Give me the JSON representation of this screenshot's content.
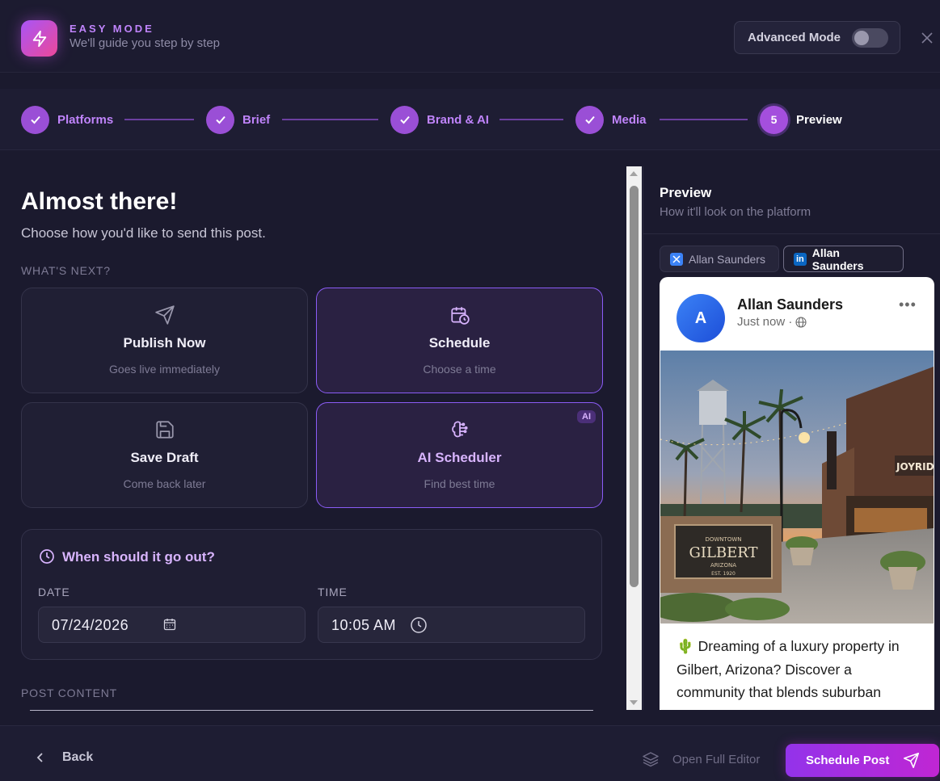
{
  "header": {
    "brand_title": "EASY MODE",
    "brand_subtitle": "We'll guide you step by step",
    "advanced_mode_label": "Advanced Mode",
    "advanced_mode_on": false,
    "close_icon": "close-icon"
  },
  "stepper": {
    "steps": [
      {
        "label": "Platforms",
        "state": "done"
      },
      {
        "label": "Brief",
        "state": "done"
      },
      {
        "label": "Brand & AI",
        "state": "done"
      },
      {
        "label": "Media",
        "state": "done"
      },
      {
        "label": "Preview",
        "state": "active",
        "number": "5"
      }
    ]
  },
  "main": {
    "title": "Almost there!",
    "subtitle": "Choose how you'd like to send this post.",
    "section_label": "WHAT'S NEXT?",
    "options": [
      {
        "title": "Publish Now",
        "subtitle": "Goes live immediately",
        "icon": "send-icon",
        "selected": false
      },
      {
        "title": "Schedule",
        "subtitle": "Choose a time",
        "icon": "calendar-clock-icon",
        "selected": true
      },
      {
        "title": "Save Draft",
        "subtitle": "Come back later",
        "icon": "save-icon",
        "selected": false
      },
      {
        "title": "AI Scheduler",
        "subtitle": "Find best time",
        "icon": "brain-icon",
        "selected": true,
        "badge": "AI"
      }
    ],
    "when": {
      "title": "When should it go out?",
      "date_label": "DATE",
      "date_value": "07/24/2026",
      "time_label": "TIME",
      "time_value": "10:05 AM"
    },
    "post_content_label": "POST CONTENT"
  },
  "preview": {
    "title": "Preview",
    "subtitle": "How it'll look on the platform",
    "tabs": [
      {
        "label": "Allan Saunders",
        "platform": "x",
        "active": false
      },
      {
        "label": "Allan Saunders",
        "platform": "linkedin",
        "active": true
      }
    ],
    "card": {
      "avatar_letter": "A",
      "name": "Allan Saunders",
      "meta": "Just now ·",
      "more": "•••",
      "image_sign_line1": "DOWNTOWN",
      "image_sign_line2": "GILBERT",
      "image_sign_line3": "ARIZONA",
      "image_sign_line4": "EST. 1920",
      "text": "🌵 Dreaming of a luxury property in Gilbert, Arizona? Discover a community that blends suburban"
    }
  },
  "footer": {
    "back_label": "Back",
    "open_editor_label": "Open Full Editor",
    "schedule_label": "Schedule Post"
  },
  "colors": {
    "accent": "#a855f7",
    "background": "#1b1a2e",
    "linkedin": "#0a66c2"
  }
}
